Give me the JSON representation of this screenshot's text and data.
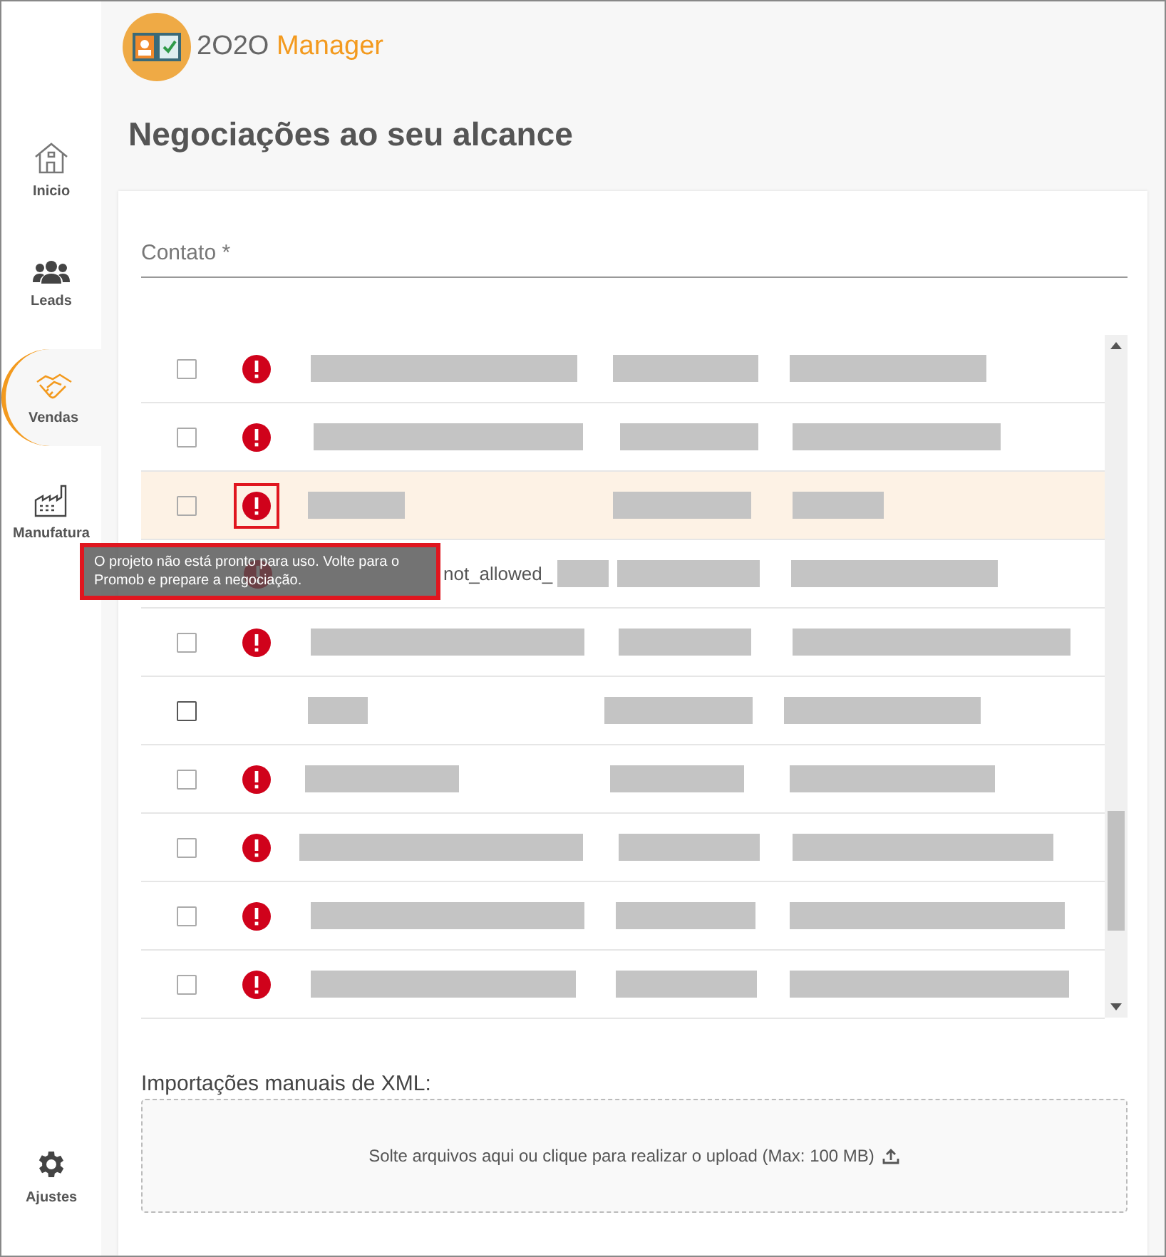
{
  "brand": {
    "name_prefix": "2O2O",
    "name_suffix": "Manager"
  },
  "sidebar": {
    "items": [
      {
        "kind": "home",
        "label": "Inicio",
        "selected": false
      },
      {
        "kind": "people",
        "label": "Leads",
        "selected": false
      },
      {
        "kind": "handshake",
        "label": "Vendas",
        "selected": true
      },
      {
        "kind": "factory",
        "label": "Manufatura",
        "selected": false
      }
    ],
    "settings": {
      "label": "Ajustes"
    }
  },
  "page_title": "Negociações ao seu alcance",
  "contact_field": {
    "placeholder": "Contato *"
  },
  "rows": [
    {
      "checked": false,
      "disabled": true,
      "warning": true,
      "hovered": false,
      "annotated": false
    },
    {
      "checked": false,
      "disabled": true,
      "warning": true,
      "hovered": false,
      "annotated": false
    },
    {
      "checked": false,
      "disabled": true,
      "warning": true,
      "hovered": true,
      "annotated": true
    },
    {
      "warning": true,
      "hovered": false,
      "annotated": false,
      "cell_text": "not_allowed_"
    },
    {
      "checked": false,
      "disabled": true,
      "warning": true,
      "hovered": false,
      "annotated": false
    },
    {
      "checked": false,
      "disabled": false,
      "warning": false,
      "hovered": false,
      "annotated": false
    },
    {
      "checked": false,
      "disabled": true,
      "warning": true,
      "hovered": false,
      "annotated": false
    },
    {
      "checked": false,
      "disabled": true,
      "warning": true,
      "hovered": false,
      "annotated": false
    },
    {
      "checked": false,
      "disabled": true,
      "warning": true,
      "hovered": false,
      "annotated": false
    },
    {
      "checked": false,
      "disabled": true,
      "warning": true,
      "hovered": false,
      "annotated": false
    }
  ],
  "tooltip": {
    "text": "O projeto não está pronto para uso. Volte para o Promob e prepare a negociação."
  },
  "xml_import": {
    "label": "Importações manuais de XML:",
    "dropzone_text": "Solte arquivos aqui ou clique para realizar o upload (Max: 100 MB)"
  }
}
